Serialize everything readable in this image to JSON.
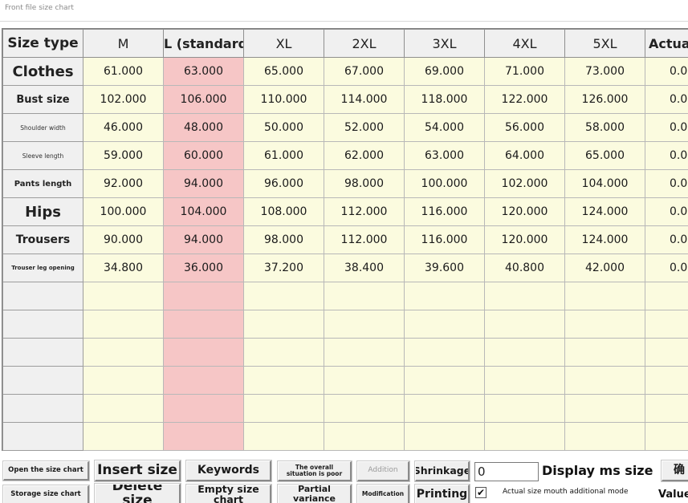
{
  "window": {
    "title": "Front file size chart"
  },
  "table": {
    "header": {
      "label": "Size type",
      "sizes": [
        "M",
        "L (standard)",
        "XL",
        "2XL",
        "3XL",
        "4XL",
        "5XL"
      ],
      "extra": "Actual"
    },
    "rows": [
      {
        "label": "Clothes",
        "values": [
          "61.000",
          "63.000",
          "65.000",
          "67.000",
          "69.000",
          "71.000",
          "73.000"
        ],
        "actual": "0.0"
      },
      {
        "label": "Bust size",
        "values": [
          "102.000",
          "106.000",
          "110.000",
          "114.000",
          "118.000",
          "122.000",
          "126.000"
        ],
        "actual": "0.0"
      },
      {
        "label": "Shoulder width",
        "values": [
          "46.000",
          "48.000",
          "50.000",
          "52.000",
          "54.000",
          "56.000",
          "58.000"
        ],
        "actual": "0.0"
      },
      {
        "label": "Sleeve length",
        "values": [
          "59.000",
          "60.000",
          "61.000",
          "62.000",
          "63.000",
          "64.000",
          "65.000"
        ],
        "actual": "0.0"
      },
      {
        "label": "Pants length",
        "values": [
          "92.000",
          "94.000",
          "96.000",
          "98.000",
          "100.000",
          "102.000",
          "104.000"
        ],
        "actual": "0.0"
      },
      {
        "label": "Hips",
        "values": [
          "100.000",
          "104.000",
          "108.000",
          "112.000",
          "116.000",
          "120.000",
          "124.000"
        ],
        "actual": "0.0"
      },
      {
        "label": "Trousers",
        "values": [
          "90.000",
          "94.000",
          "98.000",
          "112.000",
          "116.000",
          "120.000",
          "124.000"
        ],
        "actual": "0.0"
      },
      {
        "label": "Trouser leg opening",
        "values": [
          "34.800",
          "36.000",
          "37.200",
          "38.400",
          "39.600",
          "40.800",
          "42.000"
        ],
        "actual": "0.0"
      }
    ]
  },
  "toolbar": {
    "open_size_chart": "Open the size chart",
    "storage_size_chart": "Storage size chart",
    "insert_size": "Insert size",
    "delete_size": "Delete size",
    "keywords": "Keywords",
    "empty_size_chart": "Empty size chart",
    "overall_poor": "The overall situation is poor",
    "partial_variance": "Partial variance",
    "addition": "Addition",
    "modification": "Modification",
    "shrinkage": "Shrinkage",
    "printing": "Printing",
    "ms_value": "0",
    "display_ms_size": "Display ms size",
    "actual_size_mouth": "Actual size mouth additional mode",
    "actual_mode_checked": true,
    "checkbox_mark": "✔",
    "right_top": "确",
    "right_bottom": "Value"
  }
}
